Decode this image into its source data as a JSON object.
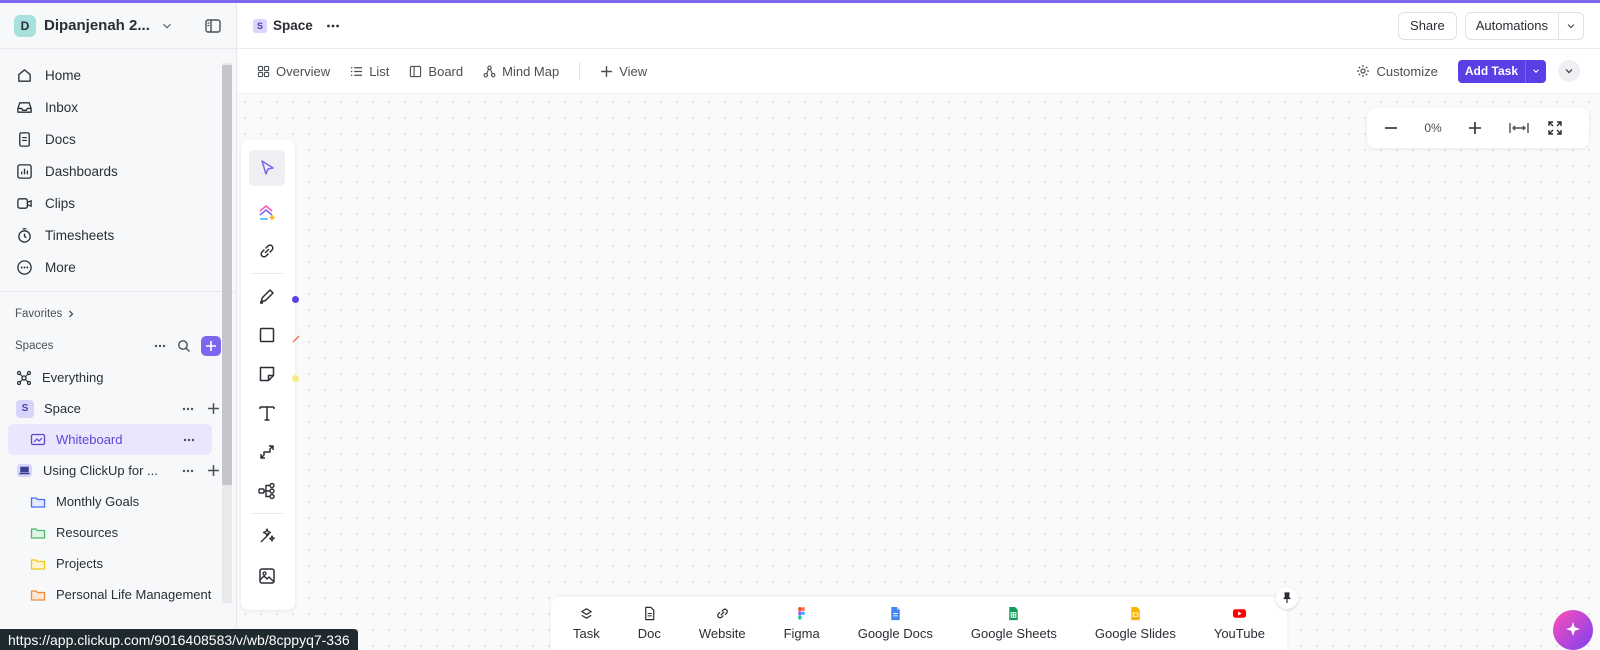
{
  "workspace": {
    "initial": "D",
    "name": "Dipanjenah 2..."
  },
  "nav": [
    {
      "label": "Home",
      "icon": "home-icon"
    },
    {
      "label": "Inbox",
      "icon": "inbox-icon"
    },
    {
      "label": "Docs",
      "icon": "docs-icon"
    },
    {
      "label": "Dashboards",
      "icon": "dashboards-icon"
    },
    {
      "label": "Clips",
      "icon": "clips-icon"
    },
    {
      "label": "Timesheets",
      "icon": "timesheets-icon"
    },
    {
      "label": "More",
      "icon": "more-icon"
    }
  ],
  "favorites": {
    "label": "Favorites"
  },
  "spaces": {
    "label": "Spaces",
    "everything": "Everything",
    "space": {
      "initial": "S",
      "label": "Space"
    },
    "whiteboard": "Whiteboard",
    "using_clickup": "Using ClickUp for ...",
    "folders": [
      "Monthly Goals",
      "Resources",
      "Projects",
      "Personal Life Management"
    ],
    "folder_colors": [
      "#4a6cf7",
      "#4bb866",
      "#f5c518",
      "#f28c3a"
    ]
  },
  "status_url": "https://app.clickup.com/9016408583/v/wb/8cppyq7-336",
  "header": {
    "crumb_initial": "S",
    "crumb_label": "Space",
    "share": "Share",
    "automations": "Automations"
  },
  "views": {
    "tabs": [
      "Overview",
      "List",
      "Board",
      "Mind Map"
    ],
    "add_view": "View",
    "customize": "Customize",
    "add_task": "Add Task"
  },
  "zoom": {
    "value": "0%"
  },
  "bottom_items": [
    "Task",
    "Doc",
    "Website",
    "Figma",
    "Google Docs",
    "Google Sheets",
    "Google Slides",
    "YouTube"
  ],
  "colors": {
    "accent": "#7b68ee",
    "add_task": "#5b3fe4",
    "pen_dot": "#5b3fe4",
    "sticky_dot": "#f8e98a"
  }
}
